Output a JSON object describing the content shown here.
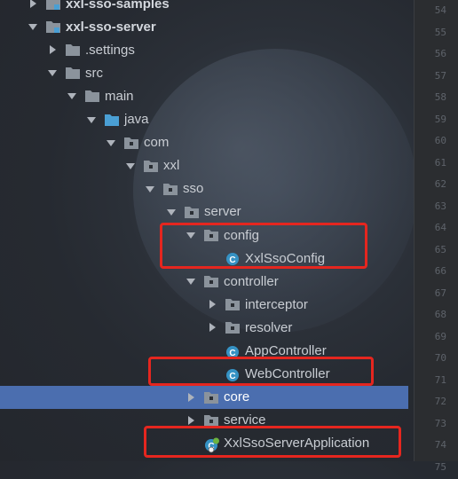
{
  "tree_items": [
    {
      "label": "xxl-sso-samples",
      "kind": "module",
      "arrow": "right",
      "bold": true
    },
    {
      "label": "xxl-sso-server",
      "kind": "module",
      "arrow": "down",
      "bold": true
    },
    {
      "label": ".settings",
      "kind": "folder",
      "arrow": "right"
    },
    {
      "label": "src",
      "kind": "folder",
      "arrow": "down"
    },
    {
      "label": "main",
      "kind": "folder",
      "arrow": "down"
    },
    {
      "label": "java",
      "kind": "source-root",
      "arrow": "down"
    },
    {
      "label": "com",
      "kind": "package",
      "arrow": "down"
    },
    {
      "label": "xxl",
      "kind": "package",
      "arrow": "down"
    },
    {
      "label": "sso",
      "kind": "package",
      "arrow": "down"
    },
    {
      "label": "server",
      "kind": "package",
      "arrow": "down"
    },
    {
      "label": "config",
      "kind": "package",
      "arrow": "down"
    },
    {
      "label": "XxlSsoConfig",
      "kind": "class",
      "arrow": "none"
    },
    {
      "label": "controller",
      "kind": "package",
      "arrow": "down"
    },
    {
      "label": "interceptor",
      "kind": "package",
      "arrow": "right"
    },
    {
      "label": "resolver",
      "kind": "package",
      "arrow": "right"
    },
    {
      "label": "AppController",
      "kind": "class",
      "arrow": "none"
    },
    {
      "label": "WebController",
      "kind": "class",
      "arrow": "none"
    },
    {
      "label": "core",
      "kind": "package",
      "arrow": "right",
      "selected": true
    },
    {
      "label": "service",
      "kind": "package",
      "arrow": "right"
    },
    {
      "label": "XxlSsoServerApplication",
      "kind": "spring-boot-class",
      "arrow": "none"
    }
  ],
  "line_numbers": [
    "54",
    "55",
    "56",
    "57",
    "58",
    "59",
    "60",
    "61",
    "62",
    "63",
    "64",
    "65",
    "66",
    "67",
    "68",
    "69",
    "70",
    "71",
    "72",
    "73",
    "74",
    "75"
  ],
  "colors": {
    "selection": "#4b6eaf",
    "highlight_box": "#e5261f",
    "class_icon": "#3592c4",
    "folder_icon": "#8b939c",
    "source_root_icon": "#4a9fd4"
  }
}
